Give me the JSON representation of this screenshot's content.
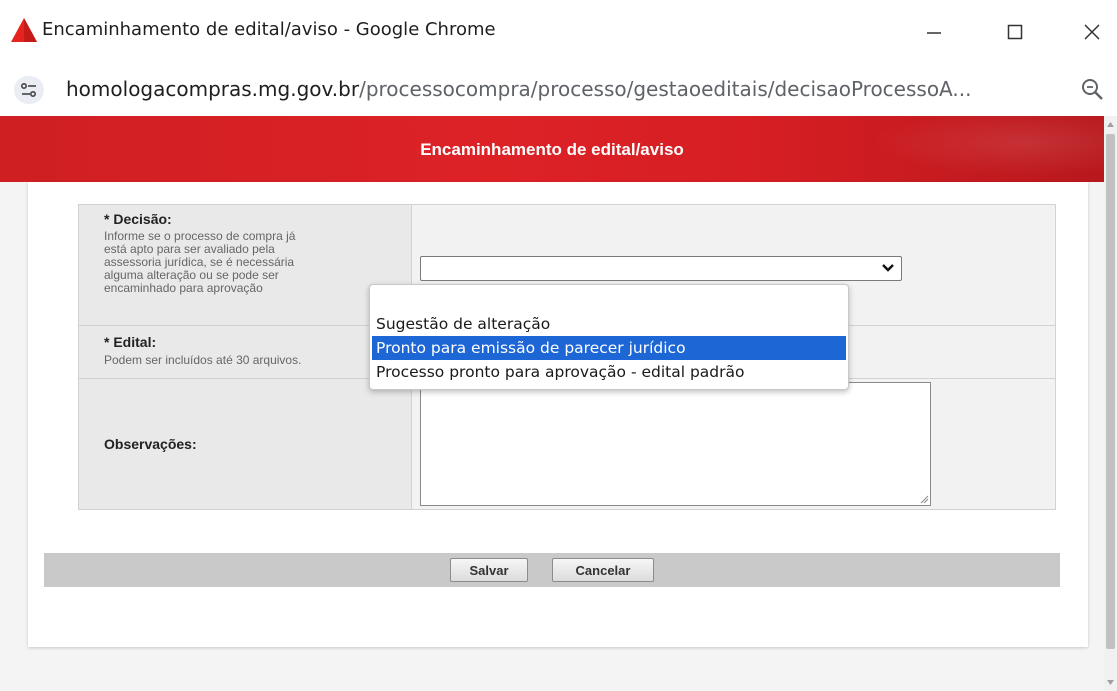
{
  "window": {
    "title": "Encaminhamento de edital/aviso - Google Chrome"
  },
  "address_bar": {
    "url_host": "homologacompras.mg.gov.br",
    "url_path": "/processocompra/processo/gestaoeditais/decisaoProcessoA..."
  },
  "modal": {
    "title": "Encaminhamento de edital/aviso"
  },
  "form": {
    "decisao": {
      "label": "* Decisão:",
      "hint_lines": [
        "Informe se o processo de compra já",
        "está apto para ser avaliado pela",
        "assessoria jurídica, se é necessária",
        "alguma alteração ou se pode ser",
        "encaminhado para aprovação"
      ],
      "selected_value": "",
      "options": [
        "",
        "Sugestão de alteração",
        "Pronto para emissão de parecer jurídico",
        "Processo pronto para aprovação - edital padrão"
      ],
      "highlighted_option": "Pronto para emissão de parecer jurídico"
    },
    "edital": {
      "label": "* Edital:",
      "hint": "Podem ser incluídos até 30 arquivos."
    },
    "observacoes": {
      "label": "Observações:",
      "value": ""
    }
  },
  "buttons": {
    "save": "Salvar",
    "cancel": "Cancelar"
  },
  "colors": {
    "header_red": "#dd2226",
    "highlight_blue": "#1d66d6",
    "logo_red": "#e6231f"
  }
}
